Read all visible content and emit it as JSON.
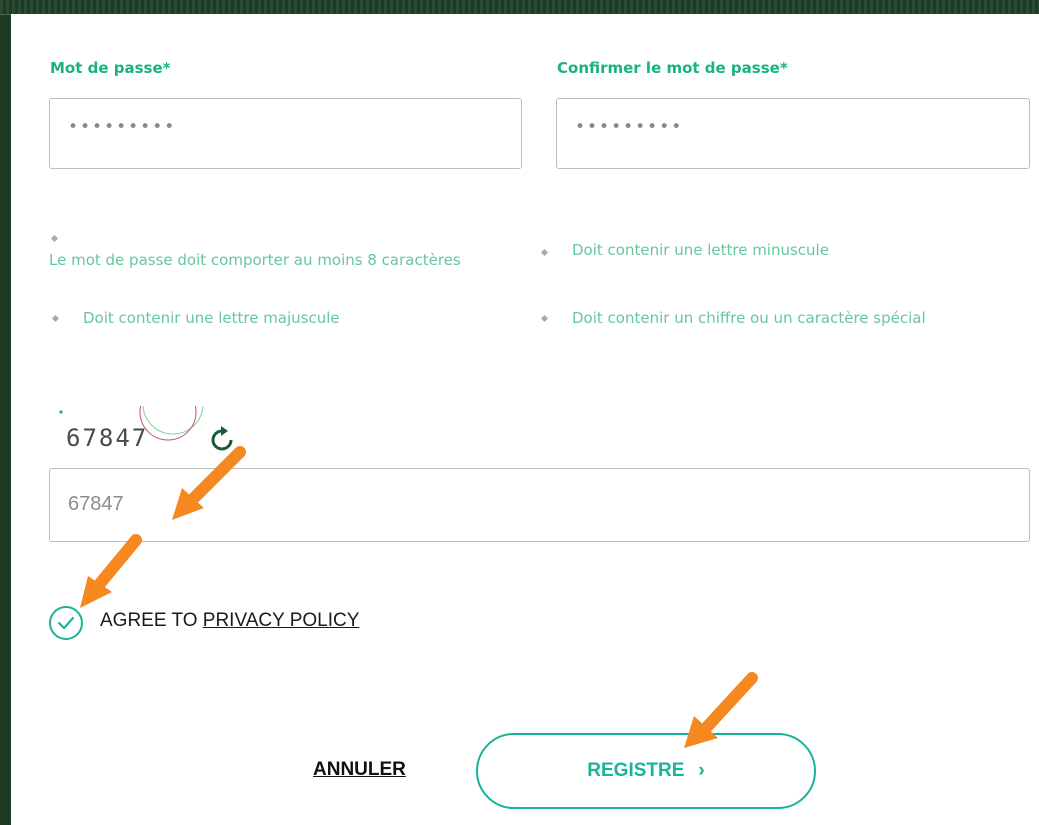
{
  "form": {
    "password_label": "Mot de passe*",
    "password_value": "•••••••••",
    "confirm_label": "Confirmer le mot de passe*",
    "confirm_value": "•••••••••",
    "rules": [
      "Le mot de passe doit comporter au moins 8 caractères",
      "Doit contenir une lettre minuscule",
      "Doit contenir une lettre majuscule",
      "Doit contenir un chiffre ou un caractère spécial"
    ],
    "captcha_text": "67847",
    "captcha_input_value": "67847",
    "agree_prefix": "AGREE TO ",
    "agree_link": "PRIVACY POLICY",
    "agree_checked": true,
    "cancel_label": "ANNULER",
    "register_label": "REGISTRE",
    "register_chevron": "›"
  },
  "icons": {
    "refresh": "refresh-icon",
    "check": "check-icon",
    "annotation_arrow": "arrow-icon"
  },
  "colors": {
    "accent": "#19b39a",
    "label_green": "#19b37f",
    "rule_green": "#66c79b",
    "annotation_orange": "#f5891f"
  }
}
